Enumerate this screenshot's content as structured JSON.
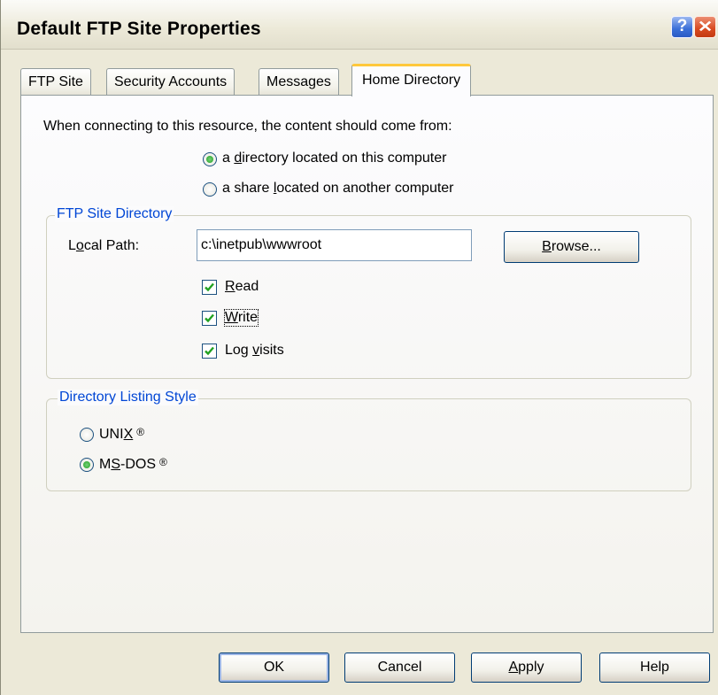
{
  "window": {
    "title": "Default FTP Site Properties",
    "help_glyph": "?",
    "close_glyph": "✕"
  },
  "tabs": [
    {
      "label": "FTP Site"
    },
    {
      "label": "Security Accounts"
    },
    {
      "label": "Messages"
    },
    {
      "label": "Home Directory",
      "active": true
    }
  ],
  "content_source": {
    "prompt": "When connecting to this resource, the content should come from:",
    "option_local": {
      "pre": "a ",
      "mnemonic": "d",
      "post": "irectory located on this computer",
      "checked": true
    },
    "option_share": {
      "pre": "a share ",
      "mnemonic": "l",
      "post": "ocated on another computer",
      "checked": false
    }
  },
  "ftp_site_directory": {
    "legend": "FTP Site Directory",
    "local_path_label": {
      "pre": "L",
      "mnemonic": "o",
      "post": "cal Path:"
    },
    "local_path_value": "c:\\inetpub\\wwwroot",
    "browse_button": {
      "pre": "",
      "mnemonic": "B",
      "post": "rowse..."
    },
    "read": {
      "pre": "",
      "mnemonic": "R",
      "post": "ead",
      "checked": true
    },
    "write": {
      "pre": "",
      "mnemonic": "W",
      "post": "rite",
      "checked": true
    },
    "log_visits": {
      "pre": "Log ",
      "mnemonic": "v",
      "post": "isits",
      "checked": true
    }
  },
  "listing_style": {
    "legend": "Directory Listing Style",
    "unix": {
      "pre": "UNI",
      "mnemonic": "X",
      "post": "",
      "mark": "®",
      "checked": false
    },
    "msdos": {
      "pre": "M",
      "mnemonic": "S",
      "post": "-DOS",
      "mark": "®",
      "checked": true
    }
  },
  "buttons": {
    "ok": "OK",
    "cancel": "Cancel",
    "apply": {
      "pre": "",
      "mnemonic": "A",
      "post": "pply"
    },
    "help": "Help"
  },
  "colors": {
    "group_legend": "#0046d5",
    "active_tab_accent": "#ffc83c",
    "check_mark": "#21a121"
  }
}
